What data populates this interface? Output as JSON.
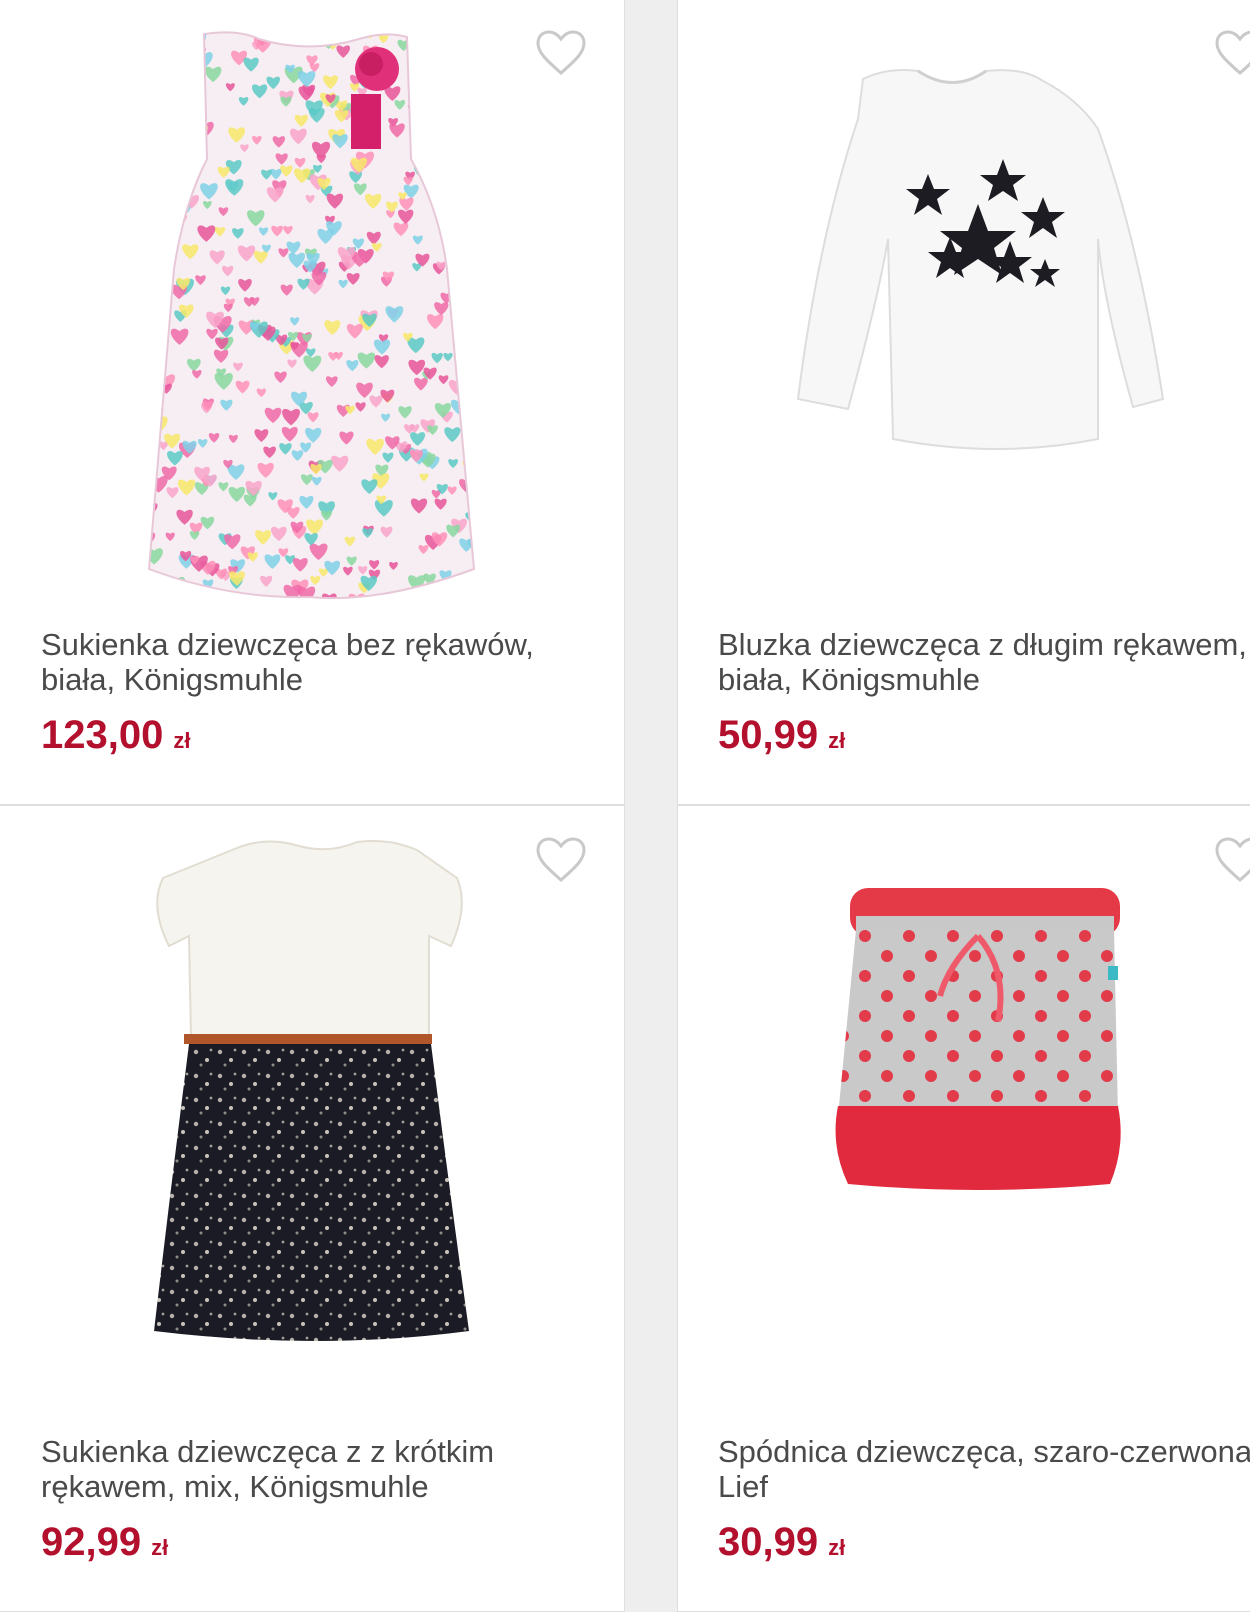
{
  "products": [
    {
      "title": "Sukienka dziewczęca bez rękawów, biała, Königsmuhle",
      "price": "123,00",
      "currency": "zł",
      "image": "floral-hearts-dress"
    },
    {
      "title": "Bluzka dziewczęca z długim rękawem, biała, Königsmuhle",
      "price": "50,99",
      "currency": "zł",
      "image": "white-stars-top"
    },
    {
      "title": "Sukienka dziewczęca z z krótkim rękawem, mix, Königsmuhle",
      "price": "92,99",
      "currency": "zł",
      "image": "white-black-floral-dress"
    },
    {
      "title": "Spódnica dziewczęca, szaro-czerwona, Lief",
      "price": "30,99",
      "currency": "zł",
      "image": "grey-red-dotted-skirt"
    }
  ],
  "icons": {
    "wishlist": "heart-outline-icon"
  },
  "colors": {
    "price": "#b3102e",
    "title": "#4a4a4a",
    "card_border": "#dedede"
  }
}
